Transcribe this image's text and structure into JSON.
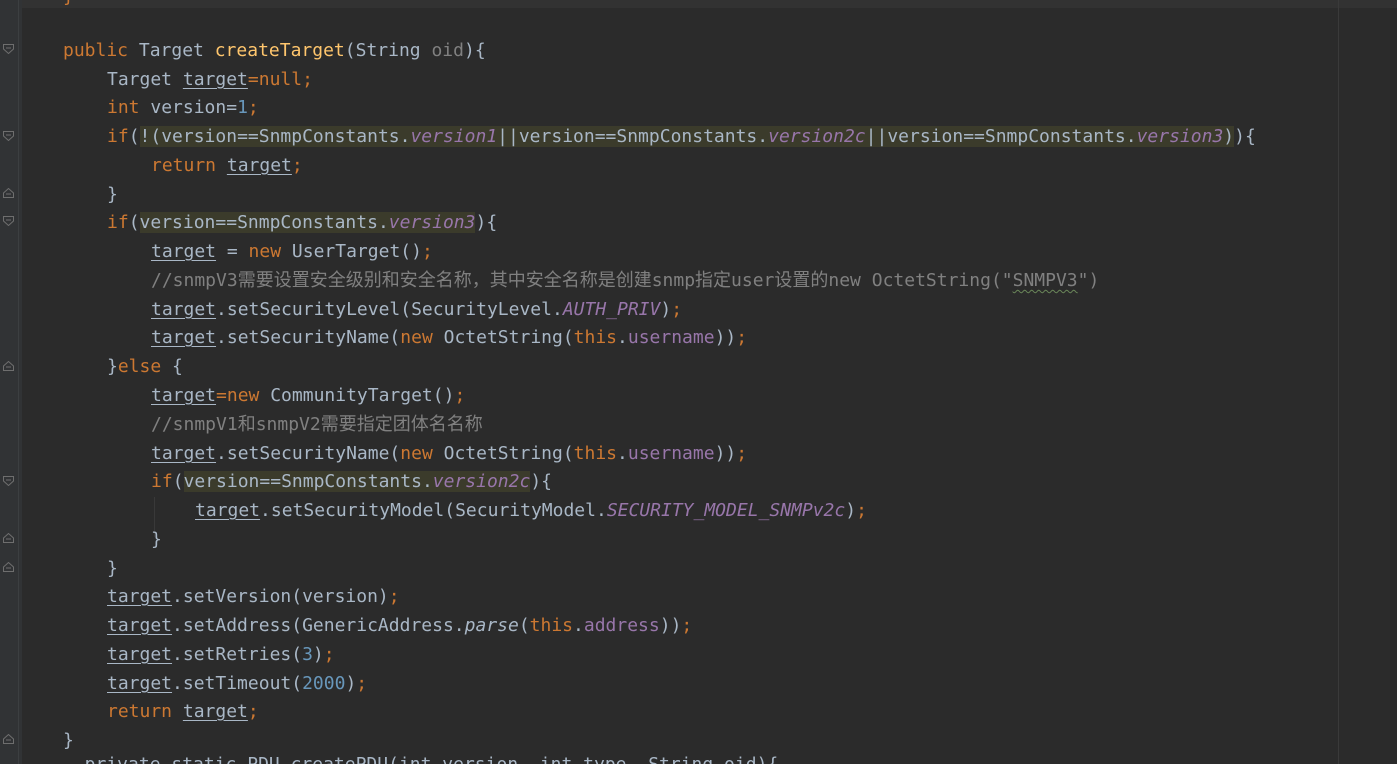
{
  "editor": {
    "top_fragment": "}",
    "lines": [
      {
        "segments": [
          [
            "kw",
            "public "
          ],
          [
            "",
            "Target "
          ],
          [
            "fn",
            "createTarget"
          ],
          [
            "",
            "(String "
          ],
          [
            "param",
            "oid"
          ],
          [
            "",
            "){"
          ]
        ]
      },
      {
        "segments": [
          [
            "",
            "Target "
          ],
          [
            "ul",
            "target"
          ],
          [
            "kw",
            "=null;"
          ]
        ]
      },
      {
        "segments": [
          [
            "kw",
            "int "
          ],
          [
            "",
            "version="
          ],
          [
            "num",
            "1"
          ],
          [
            "kw",
            ";"
          ]
        ]
      },
      {
        "segments": [
          [
            "kw",
            "if"
          ],
          [
            "",
            "("
          ],
          [
            "hl",
            "!(version==SnmpConstants."
          ],
          [
            "hl sfield",
            "version1"
          ],
          [
            "hl",
            "||version==SnmpConstants."
          ],
          [
            "hl sfield",
            "version2c"
          ],
          [
            "hl",
            "||version==SnmpConstants."
          ],
          [
            "hl sfield",
            "version3"
          ],
          [
            "hl",
            ")"
          ],
          [
            "",
            "){"
          ]
        ]
      },
      {
        "segments": [
          [
            "kw",
            "return "
          ],
          [
            "ul",
            "target"
          ],
          [
            "kw",
            ";"
          ]
        ]
      },
      {
        "segments": [
          [
            "",
            "}"
          ]
        ]
      },
      {
        "segments": [
          [
            "kw",
            "if"
          ],
          [
            "",
            "("
          ],
          [
            "hl",
            "version==SnmpConstants."
          ],
          [
            "hl sfield",
            "version3"
          ],
          [
            "",
            "){"
          ]
        ]
      },
      {
        "segments": [
          [
            "ul",
            "target"
          ],
          [
            "",
            " = "
          ],
          [
            "kw",
            "new "
          ],
          [
            "",
            "UserTarget()"
          ],
          [
            "kw",
            ";"
          ]
        ]
      },
      {
        "segments": [
          [
            "comment",
            "//snmpV3需要设置安全级别和安全名称，其中安全名称是创建snmp指定user设置的new OctetString(\""
          ],
          [
            "comment typo",
            "SNMPV3"
          ],
          [
            "comment",
            "\")"
          ]
        ]
      },
      {
        "segments": [
          [
            "ul",
            "target"
          ],
          [
            "",
            ".setSecurityLevel(SecurityLevel."
          ],
          [
            "sfield",
            "AUTH_PRIV"
          ],
          [
            "",
            ")"
          ],
          [
            "kw",
            ";"
          ]
        ]
      },
      {
        "segments": [
          [
            "ul",
            "target"
          ],
          [
            "",
            ".setSecurityName("
          ],
          [
            "kw",
            "new "
          ],
          [
            "",
            "OctetString("
          ],
          [
            "kw",
            "this"
          ],
          [
            "",
            "."
          ],
          [
            "field",
            "username"
          ],
          [
            "",
            "))"
          ],
          [
            "kw",
            ";"
          ]
        ]
      },
      {
        "segments": [
          [
            "",
            "}"
          ],
          [
            "kw",
            "else "
          ],
          [
            "",
            "{"
          ]
        ]
      },
      {
        "segments": [
          [
            "ul",
            "target"
          ],
          [
            "kw",
            "=new "
          ],
          [
            "",
            "CommunityTarget()"
          ],
          [
            "kw",
            ";"
          ]
        ]
      },
      {
        "segments": [
          [
            "comment",
            "//snmpV1和snmpV2需要指定团体名名称"
          ]
        ]
      },
      {
        "segments": [
          [
            "ul",
            "target"
          ],
          [
            "",
            ".setSecurityName("
          ],
          [
            "kw",
            "new "
          ],
          [
            "",
            "OctetString("
          ],
          [
            "kw",
            "this"
          ],
          [
            "",
            "."
          ],
          [
            "field",
            "username"
          ],
          [
            "",
            "))"
          ],
          [
            "kw",
            ";"
          ]
        ]
      },
      {
        "segments": [
          [
            "kw",
            "if"
          ],
          [
            "",
            "("
          ],
          [
            "hl",
            "version==SnmpConstants."
          ],
          [
            "hl sfield",
            "version2c"
          ],
          [
            "",
            "){"
          ]
        ]
      },
      {
        "segments": [
          [
            "ul",
            "target"
          ],
          [
            "",
            ".setSecurityModel(SecurityModel."
          ],
          [
            "sfield",
            "SECURITY_MODEL_SNMPv2c"
          ],
          [
            "",
            ")"
          ],
          [
            "kw",
            ";"
          ]
        ]
      },
      {
        "segments": [
          [
            "",
            "}"
          ]
        ]
      },
      {
        "segments": [
          [
            "",
            "}"
          ]
        ]
      },
      {
        "segments": [
          [
            "ul",
            "target"
          ],
          [
            "",
            ".setVersion(version)"
          ],
          [
            "kw",
            ";"
          ]
        ]
      },
      {
        "segments": [
          [
            "ul",
            "target"
          ],
          [
            "",
            ".setAddress(GenericAddress."
          ],
          [
            "smethod",
            "parse"
          ],
          [
            "",
            "("
          ],
          [
            "kw",
            "this"
          ],
          [
            "",
            "."
          ],
          [
            "field",
            "address"
          ],
          [
            "",
            "))"
          ],
          [
            "kw",
            ";"
          ]
        ]
      },
      {
        "segments": [
          [
            "ul",
            "target"
          ],
          [
            "",
            ".setRetries("
          ],
          [
            "num",
            "3"
          ],
          [
            "",
            ")"
          ],
          [
            "kw",
            ";"
          ]
        ]
      },
      {
        "segments": [
          [
            "ul",
            "target"
          ],
          [
            "",
            ".setTimeout("
          ],
          [
            "num",
            "2000"
          ],
          [
            "",
            ")"
          ],
          [
            "kw",
            ";"
          ]
        ]
      },
      {
        "segments": [
          [
            "kw",
            "return "
          ],
          [
            "ul",
            "target"
          ],
          [
            "kw",
            ";"
          ]
        ]
      },
      {
        "segments": [
          [
            "",
            "}"
          ]
        ]
      }
    ],
    "bottom_fragment": "  private static PDU createPDU(int version, int type, String oid){"
  },
  "colors": {
    "background": "#2b2b2b",
    "keyword": "#cc7832",
    "number": "#6897bb",
    "method_decl": "#ffc66d",
    "field": "#9876aa",
    "comment": "#808080",
    "text": "#a9b7c6"
  },
  "icons": [
    "fold-open-icon",
    "fold-close-icon"
  ]
}
